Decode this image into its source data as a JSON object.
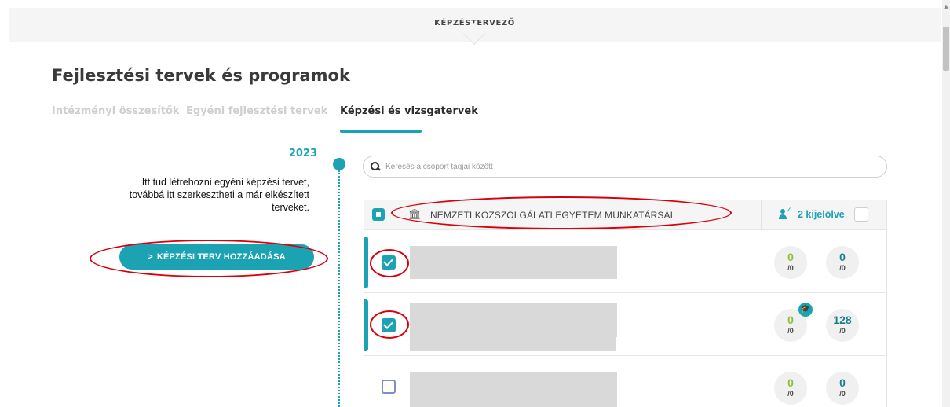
{
  "topbar": {
    "title": "KÉPZÉSTERVEZŐ"
  },
  "page": {
    "title": "Fejlesztési tervek és programok"
  },
  "tabs": [
    {
      "label": "Intézményi összesítők",
      "active": false
    },
    {
      "label": "Egyéni fejlesztési tervek",
      "active": false
    },
    {
      "label": "Képzési és vizsgatervek",
      "active": true
    }
  ],
  "timeline": {
    "year": "2023"
  },
  "intro": {
    "line1": "Itt tud létrehozni egyéni képzési tervet,",
    "line2": "továbbá itt szerkesztheti a már elkészített",
    "line3": "terveket."
  },
  "add_button": {
    "label": "KÉPZÉSI TERV HOZZÁADÁSA"
  },
  "search": {
    "placeholder": "Keresés a csoport tagjai között",
    "value": ""
  },
  "group": {
    "name": "NEMZETI KÖZSZOLGÁLATI EGYETEM MUNKATÁRSAI",
    "selected_label": "2 kijelölve",
    "header_checkbox": "partial"
  },
  "rows": [
    {
      "checked": true,
      "stat1": {
        "value": "0",
        "total": "/0"
      },
      "stat2": {
        "value": "0",
        "total": "/0"
      }
    },
    {
      "checked": true,
      "stat1": {
        "value": "0",
        "total": "/0"
      },
      "stat2": {
        "value": "128",
        "total": "/0"
      },
      "badge": "graduation-cap-icon"
    },
    {
      "checked": false,
      "stat1": {
        "value": "0",
        "total": "/0"
      },
      "stat2": {
        "value": "0",
        "total": "/0"
      }
    }
  ],
  "colors": {
    "accent": "#1ba3b4",
    "highlight": "#d9000d",
    "green": "#8bbf3a"
  }
}
